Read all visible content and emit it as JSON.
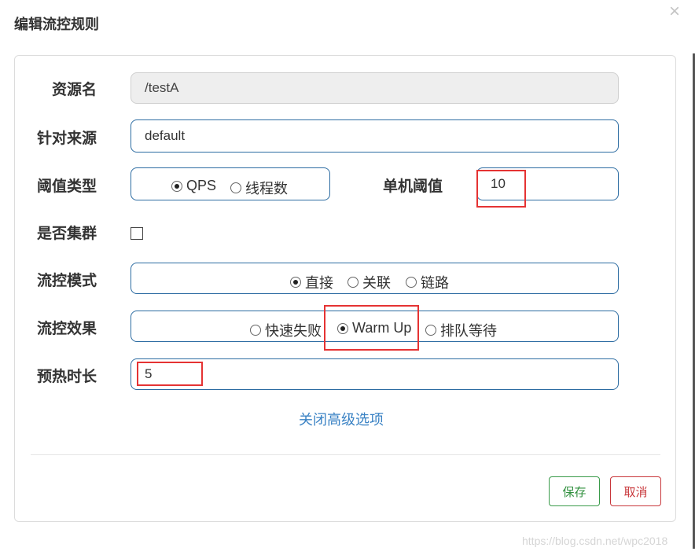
{
  "dialog": {
    "title": "编辑流控规则",
    "close_icon": "×"
  },
  "form": {
    "resource_label": "资源名",
    "resource_value": "/testA",
    "source_label": "针对来源",
    "source_value": "default",
    "threshold_type_label": "阈值类型",
    "threshold_type_options": [
      {
        "label": "QPS",
        "selected": true
      },
      {
        "label": "线程数",
        "selected": false
      }
    ],
    "single_threshold_label": "单机阈值",
    "single_threshold_value": "10",
    "cluster_label": "是否集群",
    "cluster_checked": false,
    "mode_label": "流控模式",
    "mode_options": [
      {
        "label": "直接",
        "selected": true
      },
      {
        "label": "关联",
        "selected": false
      },
      {
        "label": "链路",
        "selected": false
      }
    ],
    "effect_label": "流控效果",
    "effect_options": [
      {
        "label": "快速失败",
        "selected": false
      },
      {
        "label": "Warm Up",
        "selected": true
      },
      {
        "label": "排队等待",
        "selected": false
      }
    ],
    "warmup_label": "预热时长",
    "warmup_value": "5",
    "advanced_toggle": "关闭高级选项"
  },
  "footer": {
    "save_label": "保存",
    "cancel_label": "取消"
  },
  "watermark": "https://blog.csdn.net/wpc2018",
  "colors": {
    "input_border": "#2d6ca2",
    "highlight": "#e53333",
    "save": "#2f8f3d",
    "cancel": "#c8373b",
    "link": "#3a82c4"
  }
}
